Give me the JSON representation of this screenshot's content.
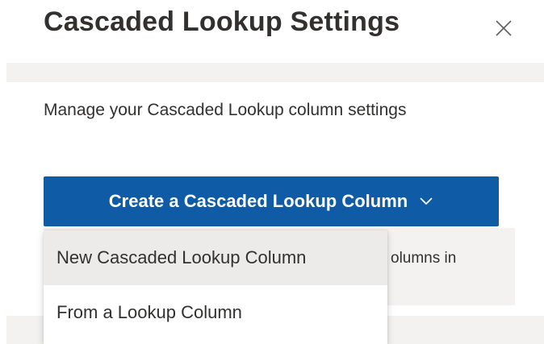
{
  "panel": {
    "title": "Cascaded Lookup Settings"
  },
  "main": {
    "description": "Manage your Cascaded Lookup column settings",
    "create_button_label": "Create a Cascaded Lookup Column",
    "info_partial_text": "olumns in"
  },
  "dropdown": {
    "items": [
      {
        "label": "New Cascaded Lookup Column"
      },
      {
        "label": "From a Lookup Column"
      }
    ]
  },
  "icons": {
    "close": "close-icon",
    "chevron": "chevron-down-icon"
  },
  "colors": {
    "accent": "#0f5ba5",
    "band": "#f3f2f1",
    "hover": "#edebe9"
  }
}
